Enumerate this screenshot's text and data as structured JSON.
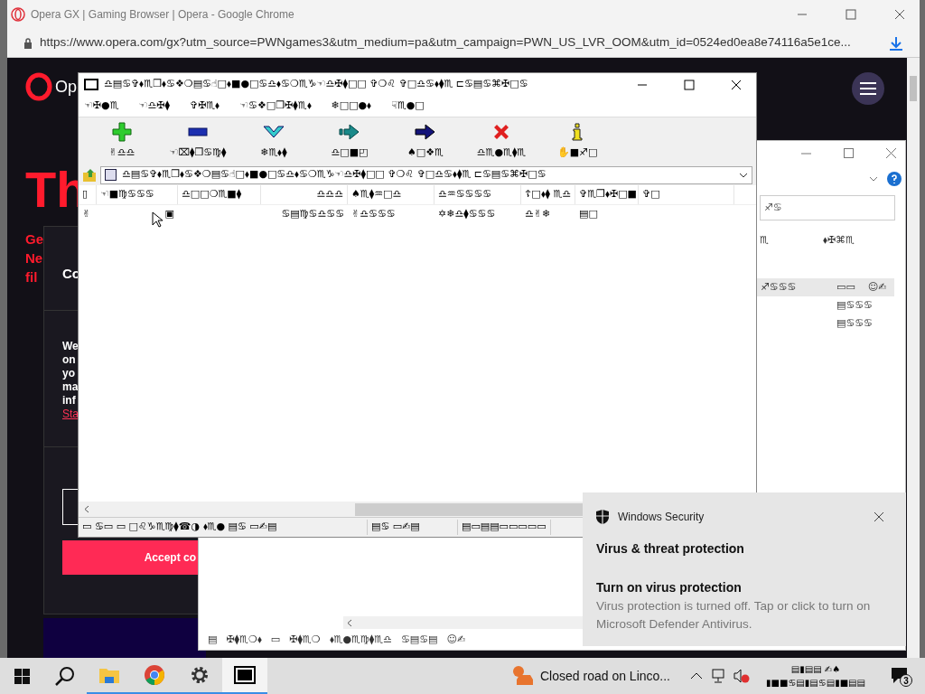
{
  "browser": {
    "title": "Opera GX | Gaming Browser | Opera - Google Chrome",
    "url": "https://www.opera.com/gx?utm_source=PWNgames3&utm_medium=pa&utm_campaign=PWN_US_LVR_OOM&utm_id=0524ed0ea8e74116a5e1ce...",
    "page": {
      "logo_text": "Op",
      "headline": "Th",
      "subhead": [
        "Ge",
        "Ne",
        "fil"
      ],
      "dialog_title": "Co",
      "dialog_lines": [
        "We",
        "on",
        "yo",
        "ma",
        "inf"
      ],
      "dialog_link": "Sta",
      "accept_button": "Accept co"
    }
  },
  "archive_window": {
    "title": "♎▤♋✞⬧♏❒⬧♋❖❍▤♋☝□⬧■●□♋♎⬧♋❍♏♑☜♎✠⧫□□ ✞❍♌ ✞□♎♋⬧⧫♏ ⊏♋▤♋⌘✠□♋",
    "menu": [
      "☜✠●♏",
      "☜♎✠⧫",
      "✞✠♏⬧",
      "☜♋❖□❒✠⧫♏⬧",
      "❄□□●⬧",
      "☟♏●□"
    ],
    "toolbar": [
      {
        "kind": "add",
        "label": "✌♎♎"
      },
      {
        "kind": "extract",
        "label": "☜⌧⧫❒♋♍⧫"
      },
      {
        "kind": "test",
        "label": "❄♏⬧⧫"
      },
      {
        "kind": "copy",
        "label": "♎□■◰"
      },
      {
        "kind": "move",
        "label": "♠□❖♏"
      },
      {
        "kind": "delete",
        "label": "♎♏●♏⧫♏"
      },
      {
        "kind": "info",
        "label": "✋■♐□"
      }
    ],
    "address": "♎▤♋✞⬧♏❒⬧♋❖❍▤♋☝□⬧■●□♋♎⬧♋❍♏♑☜♎✠⧫□□ ✞❍♌ ✞□♎♋⬧⧫♏ ⊏♋▤♋⌘✠□♋",
    "columns": [
      "▯",
      "☜■♍♋♋♋",
      "♎□□❍♏■⧫",
      "♎♎♎",
      "♠♏⧫♒□♎",
      "♎♒♋♋♋♋",
      "☦□⬧⧫ ♏♎",
      "✞♏❒⬧✠□■",
      "✞□"
    ],
    "rows": [
      {
        "selected": false,
        "cells": [
          "✌",
          "▣",
          "",
          "♋▤♍♋♎♋♋",
          "✌♎♋♋♋",
          "✡❄♎⧫♋♋♋",
          "♎✌❄",
          "▤□",
          ""
        ]
      }
    ],
    "status": [
      "▭  ♋▭  ▭  □♌♑♏♍⧫☎◑  ⬧♏●  ▤♋  ▭✍▤",
      "▤♋  ▭✍▤",
      "▤▭▤▤▭▭▭▭▭"
    ]
  },
  "explorer_window": {
    "search_placeholder": "♐♋",
    "columns": [
      "♏",
      "⬧✠⌘♏"
    ],
    "rows": [
      {
        "cells": [
          "♐♋♋♋",
          "▭▭",
          "☺✍"
        ]
      },
      {
        "cells": [
          "",
          "▤♋♋♋"
        ]
      },
      {
        "cells": [
          "",
          "▤♋♋♋"
        ]
      }
    ],
    "status": [
      "▤",
      "✠⧫♏❍⬧",
      "▭",
      "✠⧫♏❍",
      "⬧♏●♏♍⧫♏♎",
      "♋▤♋▤",
      "☺✍"
    ]
  },
  "toast": {
    "app": "Windows Security",
    "heading": "Virus & threat protection",
    "title": "Turn on virus protection",
    "body": "Virus protection is turned off. Tap or click to turn on Microsoft Defender Antivirus."
  },
  "taskbar": {
    "apps": [
      {
        "kind": "explorer",
        "active": false
      },
      {
        "kind": "chrome",
        "active": false
      },
      {
        "kind": "settings",
        "active": false
      },
      {
        "kind": "archiver",
        "active": true
      }
    ],
    "news": "Closed road on Linco...",
    "clock": [
      "▤▮▤▤  ✍♠",
      "▮■■♋▤▮▤♋▤▮■▤▤"
    ],
    "notifications": "3"
  }
}
